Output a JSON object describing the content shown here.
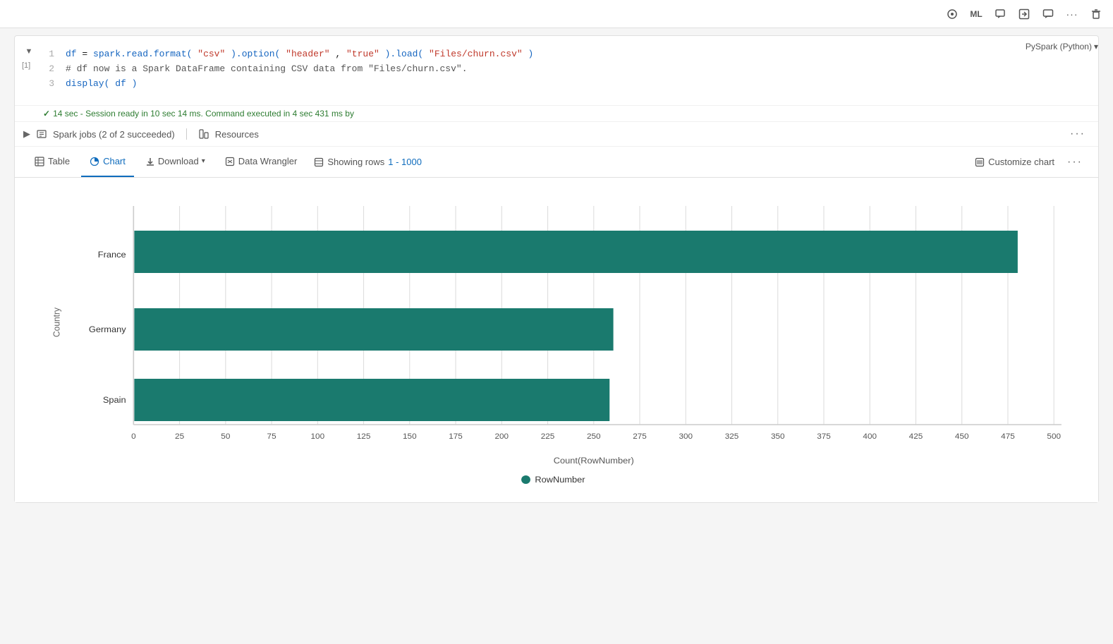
{
  "toolbar": {
    "icons": [
      "live-icon",
      "ml-icon",
      "comment-icon",
      "share-icon",
      "chat-icon",
      "more-icon",
      "delete-icon"
    ]
  },
  "cell": {
    "number": "[1]",
    "status": "14 sec - Session ready in 10 sec 14 ms. Command executed in 4 sec 431 ms by",
    "status_check": "✓",
    "pyspark_label": "PySpark (Python)",
    "code_lines": [
      {
        "num": "1",
        "text": "df = spark.read.format(\"csv\").option(\"header\",\"true\").load(\"Files/churn.csv\")"
      },
      {
        "num": "2",
        "text": "# df now is a Spark DataFrame containing CSV data from \"Files/churn.csv\"."
      },
      {
        "num": "3",
        "text": "display(df)"
      }
    ]
  },
  "spark_jobs": {
    "label": "Spark jobs (2 of 2 succeeded)",
    "resources_label": "Resources"
  },
  "tabs": {
    "table_label": "Table",
    "chart_label": "Chart",
    "download_label": "Download",
    "data_wrangler_label": "Data Wrangler",
    "showing_rows_label": "Showing rows",
    "showing_rows_range": "1 - 1000",
    "customize_chart_label": "Customize chart"
  },
  "chart": {
    "y_axis_label": "Country",
    "x_axis_label": "Count(RowNumber)",
    "legend_label": "RowNumber",
    "bar_color": "#1a7a6e",
    "bars": [
      {
        "label": "France",
        "value": 480,
        "max": 500
      },
      {
        "label": "Germany",
        "value": 260,
        "max": 500
      },
      {
        "label": "Spain",
        "value": 258,
        "max": 500
      }
    ],
    "x_ticks": [
      "0",
      "25",
      "50",
      "75",
      "100",
      "125",
      "150",
      "175",
      "200",
      "225",
      "250",
      "275",
      "300",
      "325",
      "350",
      "375",
      "400",
      "425",
      "450",
      "475",
      "500"
    ]
  }
}
